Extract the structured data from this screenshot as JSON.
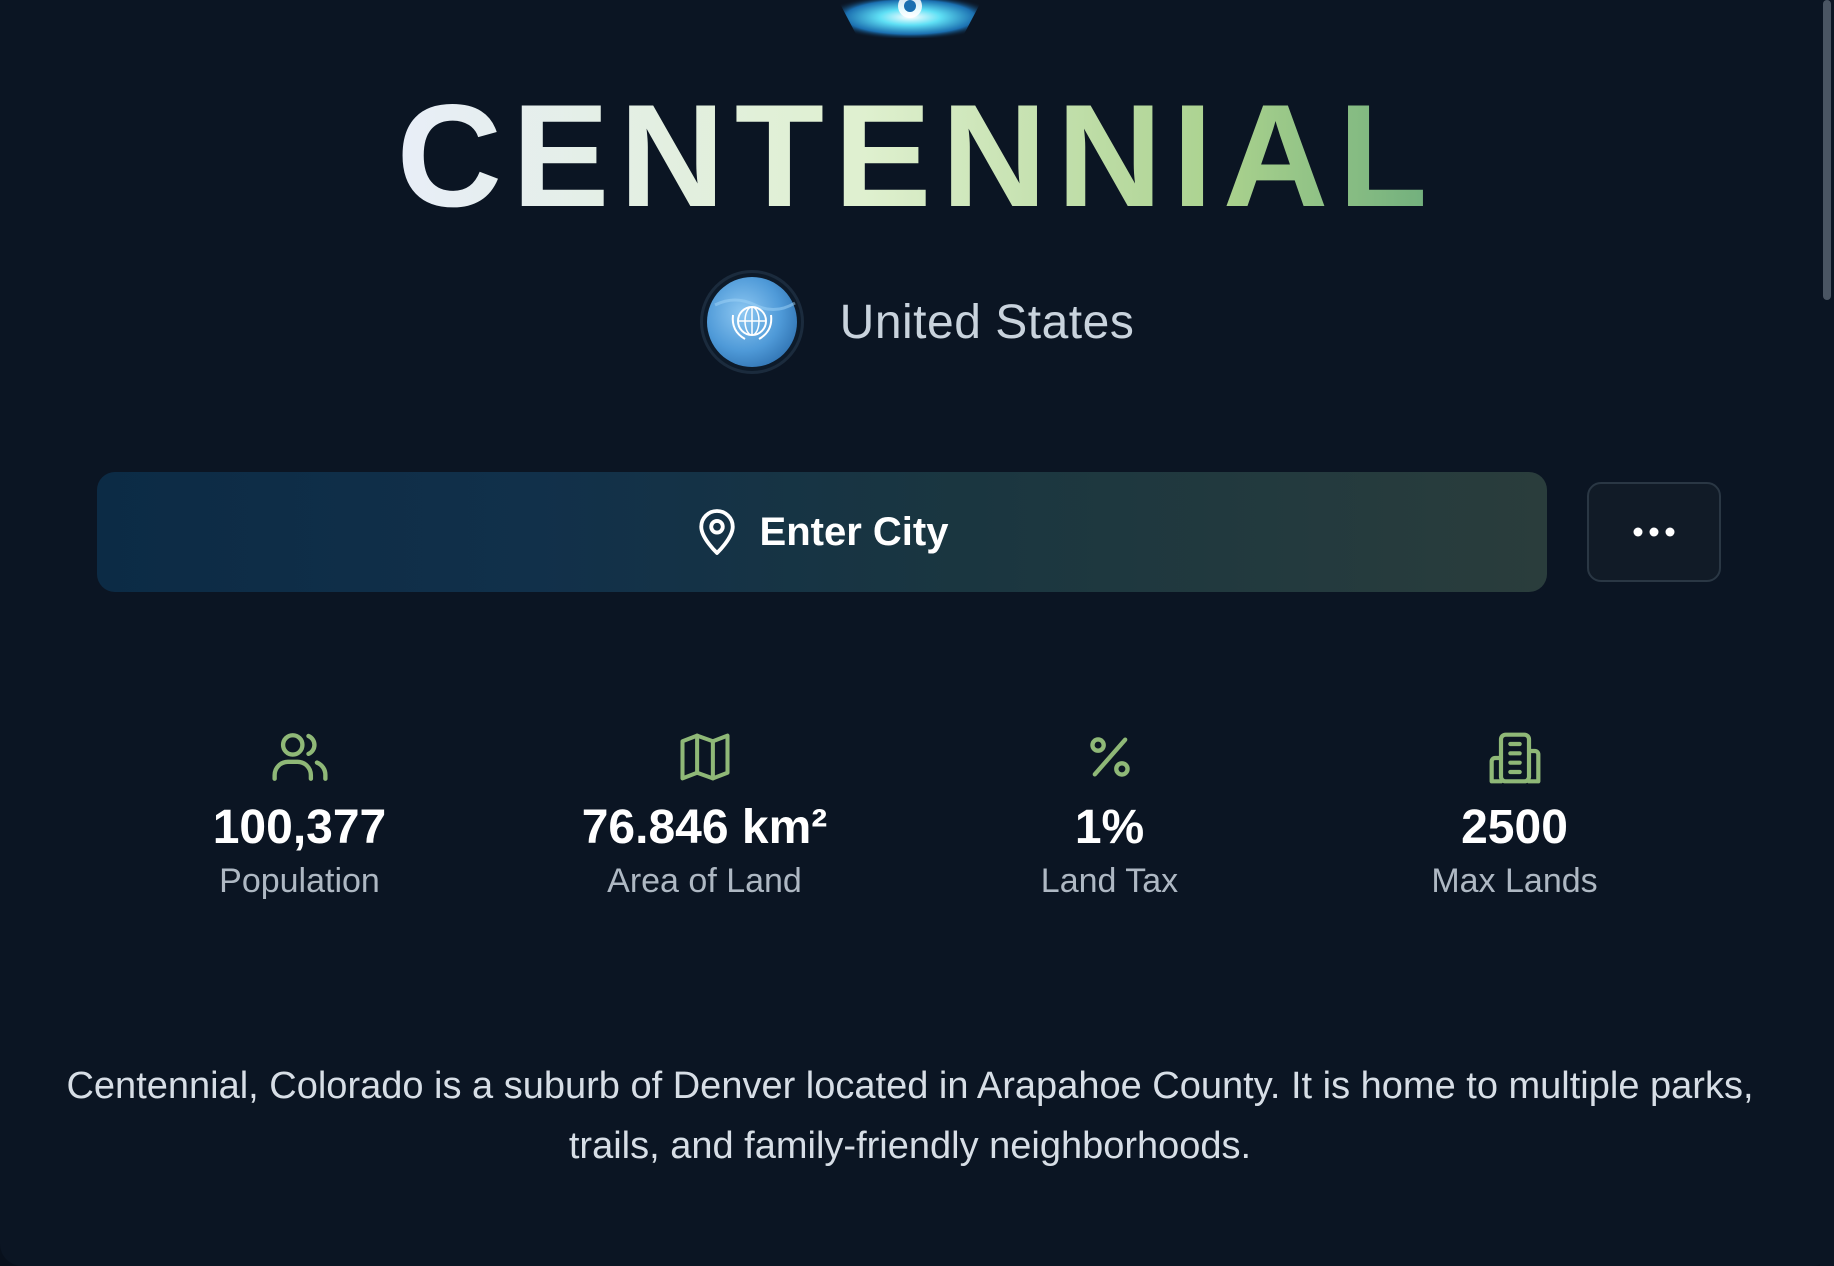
{
  "city": {
    "name": "CENTENNIAL",
    "country": "United States",
    "flag_icon": "un-flag-icon"
  },
  "actions": {
    "enter_city_label": "Enter City",
    "enter_city_icon": "map-pin-icon",
    "more_icon": "more-horizontal-icon"
  },
  "stats": [
    {
      "icon": "users-icon",
      "value": "100,377",
      "label": "Population"
    },
    {
      "icon": "map-icon",
      "value": "76.846 km²",
      "label": "Area of Land"
    },
    {
      "icon": "percent-icon",
      "value": "1%",
      "label": "Land Tax"
    },
    {
      "icon": "building-icon",
      "value": "2500",
      "label": "Max Lands"
    }
  ],
  "description": "Centennial, Colorado is a suburb of Denver located in Arapahoe County. It is home to multiple parks, trails, and family-friendly neighborhoods.",
  "colors": {
    "background": "#0b1523",
    "accent_green": "#8fb877",
    "title_gradient_start": "#e8eef8",
    "title_gradient_end": "#6fae7c"
  }
}
